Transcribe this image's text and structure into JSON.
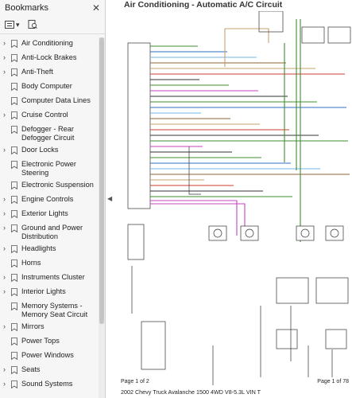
{
  "sidebar": {
    "title": "Bookmarks",
    "items": [
      {
        "label": "Air Conditioning",
        "expandable": true
      },
      {
        "label": "Anti-Lock Brakes",
        "expandable": true
      },
      {
        "label": "Anti-Theft",
        "expandable": true
      },
      {
        "label": "Body Computer",
        "expandable": false
      },
      {
        "label": "Computer Data Lines",
        "expandable": false
      },
      {
        "label": "Cruise Control",
        "expandable": true
      },
      {
        "label": "Defogger - Rear Defogger Circuit",
        "expandable": false
      },
      {
        "label": "Door Locks",
        "expandable": true
      },
      {
        "label": "Electronic Power Steering",
        "expandable": false
      },
      {
        "label": "Electronic Suspension",
        "expandable": false
      },
      {
        "label": "Engine Controls",
        "expandable": true
      },
      {
        "label": "Exterior Lights",
        "expandable": true
      },
      {
        "label": "Ground and Power Distribution",
        "expandable": true
      },
      {
        "label": "Headlights",
        "expandable": true
      },
      {
        "label": "Horns",
        "expandable": false
      },
      {
        "label": "Instruments Cluster",
        "expandable": true
      },
      {
        "label": "Interior Lights",
        "expandable": true
      },
      {
        "label": "Memory Systems - Memory Seat Circuit",
        "expandable": false
      },
      {
        "label": "Mirrors",
        "expandable": true
      },
      {
        "label": "Power Tops",
        "expandable": false
      },
      {
        "label": "Power Windows",
        "expandable": false
      },
      {
        "label": "Seats",
        "expandable": true
      },
      {
        "label": "Sound Systems",
        "expandable": true
      }
    ]
  },
  "document": {
    "title": "Air Conditioning - Automatic A/C Circuit",
    "footer_left": "Page 1 of 2",
    "footer_right": "Page 1 of 78",
    "footer_caption": "2002 Chevy Truck Avalanche 1500 4WD V8-5.3L VIN T",
    "colors": {
      "wire_green": "#3c8d2e",
      "wire_magenta": "#c742c4",
      "wire_brown": "#8d6432",
      "wire_tan": "#c7a26e",
      "wire_blue": "#2e6fc4",
      "wire_lightblue": "#6db7e6",
      "wire_red": "#d23b2e",
      "wire_black": "#333333"
    }
  }
}
